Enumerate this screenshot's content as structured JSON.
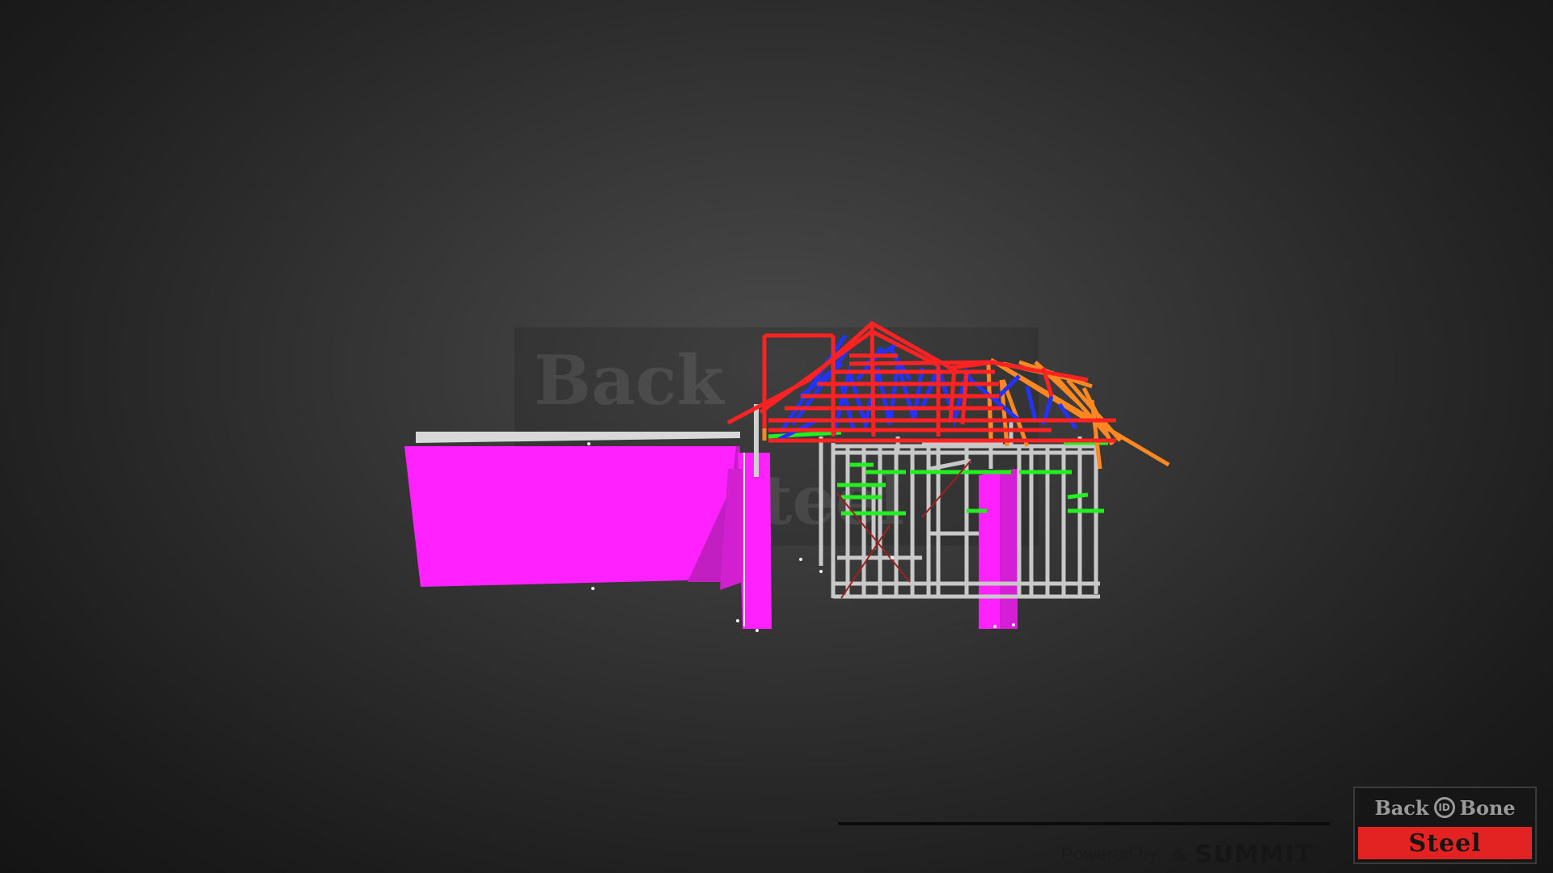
{
  "viewer": {
    "background_center_color": "#4a4a4a",
    "background_edge_color": "#141414",
    "model_colors": {
      "wall_panel": "#ff22ff",
      "frame_steel": "#c8c8c8",
      "roof_truss": "#ff2222",
      "truss_web": "#2233ff",
      "roof_rafter": "#ff8822",
      "noggin": "#22ee22",
      "brace": "#a02020"
    },
    "watermark": {
      "text_top": "Back",
      "text_bottom": "Steel",
      "symbol": "ID"
    }
  },
  "footer": {
    "powered_label": "Powered by",
    "brand_name": "SUMMIT",
    "brand_icon": "mountain-icon"
  },
  "logo": {
    "word_left": "Back",
    "ring_symbol": "ID",
    "word_right": "Bone",
    "word_bottom": "Steel",
    "accent_color": "#e32222"
  }
}
